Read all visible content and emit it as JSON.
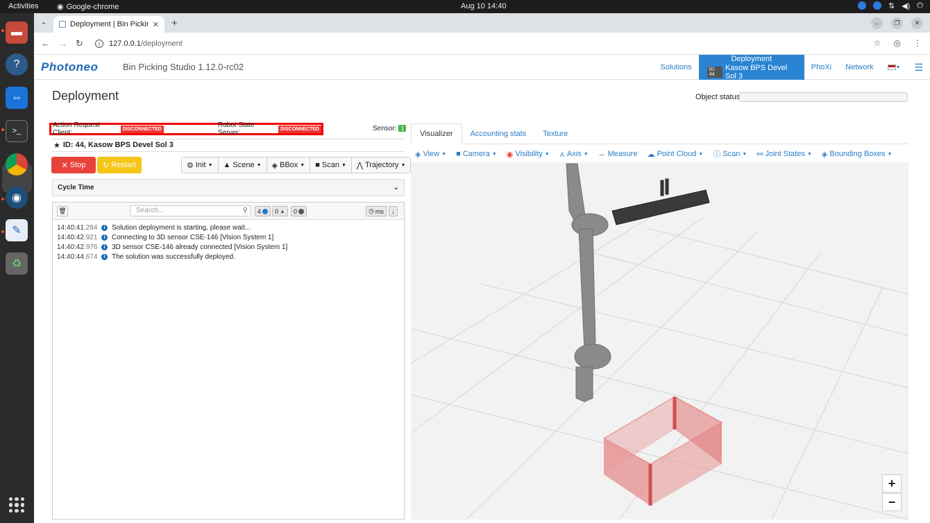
{
  "os": {
    "activities": "Activities",
    "app_name": "Google-chrome",
    "clock": "Aug 10  14:40"
  },
  "browser": {
    "tab_title": "Deployment | Bin Picking",
    "url_host": "127.0.0.1",
    "url_path": "/deployment"
  },
  "app": {
    "logo": "Photoneo",
    "title": "Bin Picking Studio 1.12.0-rc02",
    "nav": {
      "solutions": "Solutions",
      "deployment": "Deployment",
      "deployment_id": "ID: 44",
      "deployment_name": "Kasow BPS Devel Sol 3",
      "phoxi": "PhoXi",
      "network": "Network"
    }
  },
  "page": {
    "title": "Deployment",
    "object_status_label": "Object status:"
  },
  "connections": {
    "action_client_label": "Action Request Client:",
    "action_client_status": "DISCONNECTED",
    "robot_server_label": "Robot State Server:",
    "robot_server_status": "DISCONNECTED",
    "sensor_label": "Sensor:",
    "sensor_count": "1"
  },
  "solution": {
    "title": "ID: 44, Kasow BPS Devel Sol 3"
  },
  "controls": {
    "stop": "Stop",
    "restart": "Restart",
    "init": "Init",
    "scene": "Scene",
    "bbox": "BBox",
    "scan": "Scan",
    "trajectory": "Trajectory"
  },
  "cycle_time": {
    "label": "Cycle Time"
  },
  "log": {
    "search_placeholder": "Search...",
    "info_count": "4",
    "warn_count": "0",
    "error_count": "0",
    "unit": "ms",
    "lines": [
      {
        "time": "14:40:41",
        "ms": ".294",
        "msg": "Solution deployment is starting, please wait..."
      },
      {
        "time": "14:40:42",
        "ms": ".921",
        "msg": "Connecting to 3D sensor CSE-146 [Vision System 1]"
      },
      {
        "time": "14:40:42",
        "ms": ".976",
        "msg": "3D sensor CSE-146 already connected [Vision System 1]"
      },
      {
        "time": "14:40:44",
        "ms": ".674",
        "msg": "The solution was successfully deployed."
      }
    ]
  },
  "visualizer": {
    "tabs": [
      "Visualizer",
      "Accounting stats",
      "Texture"
    ],
    "toolbar": [
      "View",
      "Camera",
      "Visibility",
      "Axis",
      "Measure",
      "Point Cloud",
      "Scan",
      "Joint States",
      "Bounding Boxes"
    ],
    "zoom_in": "+",
    "zoom_out": "−"
  }
}
